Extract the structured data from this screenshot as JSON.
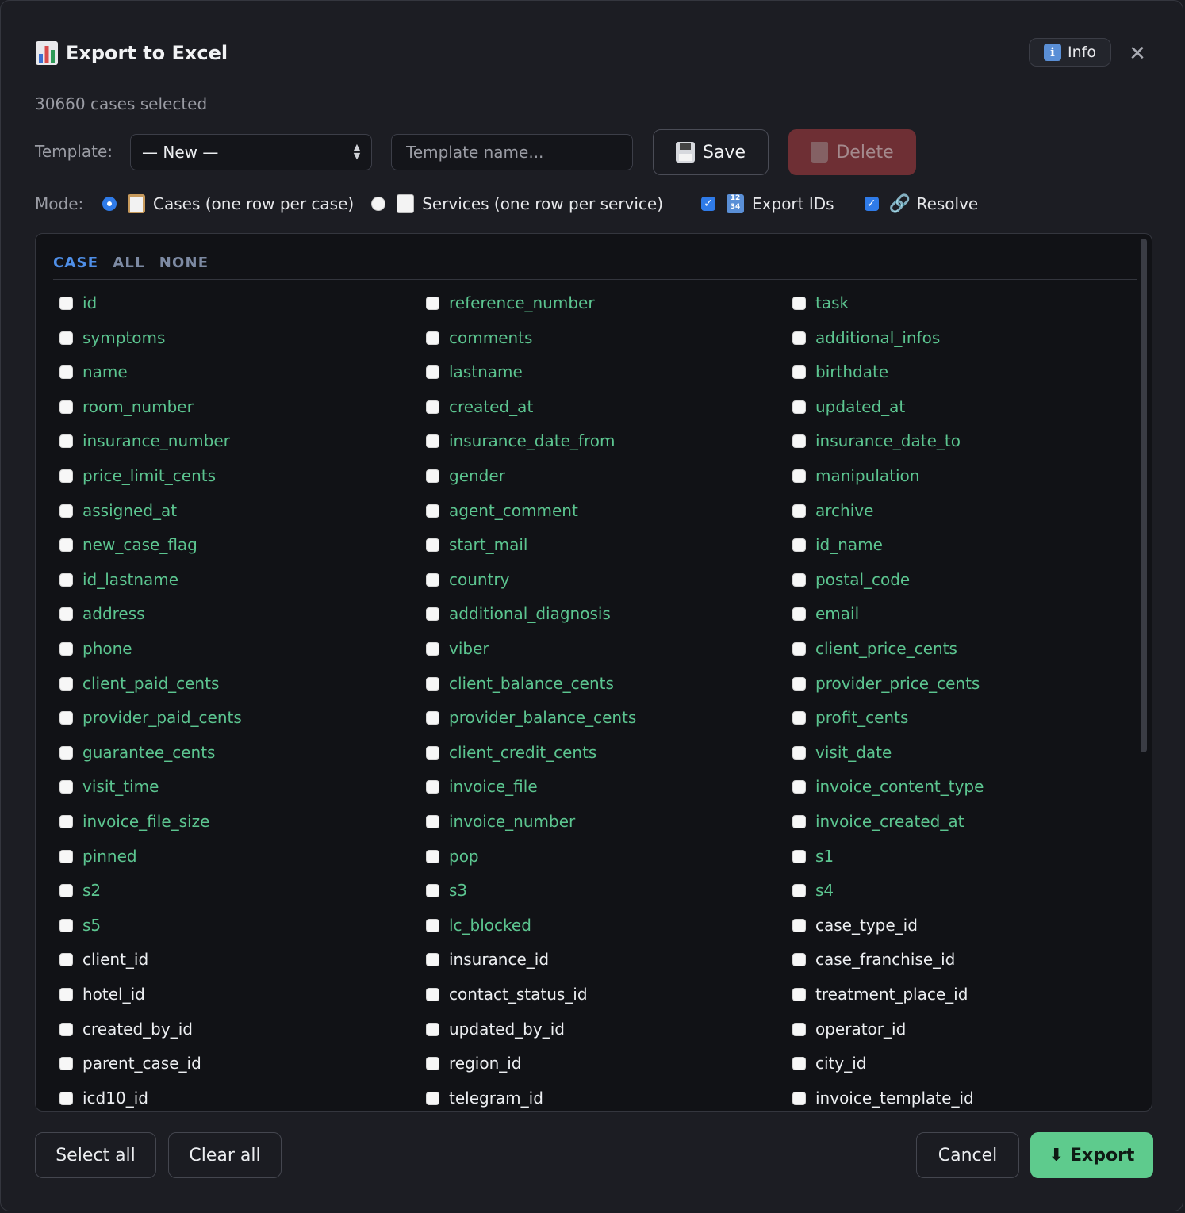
{
  "dialog": {
    "title": "Export to Excel",
    "info_label": "Info",
    "close_glyph": "✕",
    "selected_text": "30660 cases selected"
  },
  "template": {
    "label": "Template:",
    "selected": "— New —",
    "name_placeholder": "Template name...",
    "save_label": "Save",
    "delete_label": "Delete"
  },
  "mode": {
    "label": "Mode:",
    "options": [
      {
        "label": "Cases (one row per case)",
        "selected": true
      },
      {
        "label": "Services (one row per service)",
        "selected": false
      }
    ],
    "export_ids_label": "Export IDs",
    "export_ids_checked": true,
    "resolve_label": "Resolve",
    "resolve_checked": true
  },
  "fields_panel": {
    "tabs": [
      "CASE",
      "ALL",
      "NONE"
    ],
    "active_tab": "CASE",
    "columns": [
      [
        "id",
        "symptoms",
        "name",
        "room_number",
        "insurance_number",
        "price_limit_cents",
        "assigned_at",
        "new_case_flag",
        "id_lastname",
        "address",
        "phone",
        "client_paid_cents",
        "provider_paid_cents",
        "guarantee_cents",
        "visit_time",
        "invoice_file_size",
        "pinned",
        "s2",
        "s5",
        "client_id",
        "hotel_id",
        "created_by_id",
        "parent_case_id",
        "icd10_id"
      ],
      [
        "reference_number",
        "comments",
        "lastname",
        "created_at",
        "insurance_date_from",
        "gender",
        "agent_comment",
        "start_mail",
        "country",
        "additional_diagnosis",
        "viber",
        "client_balance_cents",
        "provider_balance_cents",
        "client_credit_cents",
        "invoice_file",
        "invoice_number",
        "pop",
        "s3",
        "lc_blocked",
        "insurance_id",
        "contact_status_id",
        "updated_by_id",
        "region_id",
        "telegram_id"
      ],
      [
        "task",
        "additional_infos",
        "birthdate",
        "updated_at",
        "insurance_date_to",
        "manipulation",
        "archive",
        "id_name",
        "postal_code",
        "email",
        "client_price_cents",
        "provider_price_cents",
        "profit_cents",
        "visit_date",
        "invoice_content_type",
        "invoice_created_at",
        "s1",
        "s4",
        "case_type_id",
        "case_franchise_id",
        "treatment_place_id",
        "operator_id",
        "city_id",
        "invoice_template_id"
      ]
    ],
    "white_fields": [
      "client_id",
      "hotel_id",
      "created_by_id",
      "parent_case_id",
      "icd10_id",
      "insurance_id",
      "contact_status_id",
      "updated_by_id",
      "region_id",
      "telegram_id",
      "case_type_id",
      "case_franchise_id",
      "treatment_place_id",
      "operator_id",
      "city_id",
      "invoice_template_id"
    ],
    "field_color": "#5cc590",
    "id_field_color": "#eceef1"
  },
  "footer": {
    "select_all_label": "Select all",
    "clear_all_label": "Clear all",
    "cancel_label": "Cancel",
    "export_label": "Export"
  },
  "colors": {
    "accent": "#2f7be8",
    "export": "#5ecb8d",
    "delete": "#6e2f34"
  }
}
